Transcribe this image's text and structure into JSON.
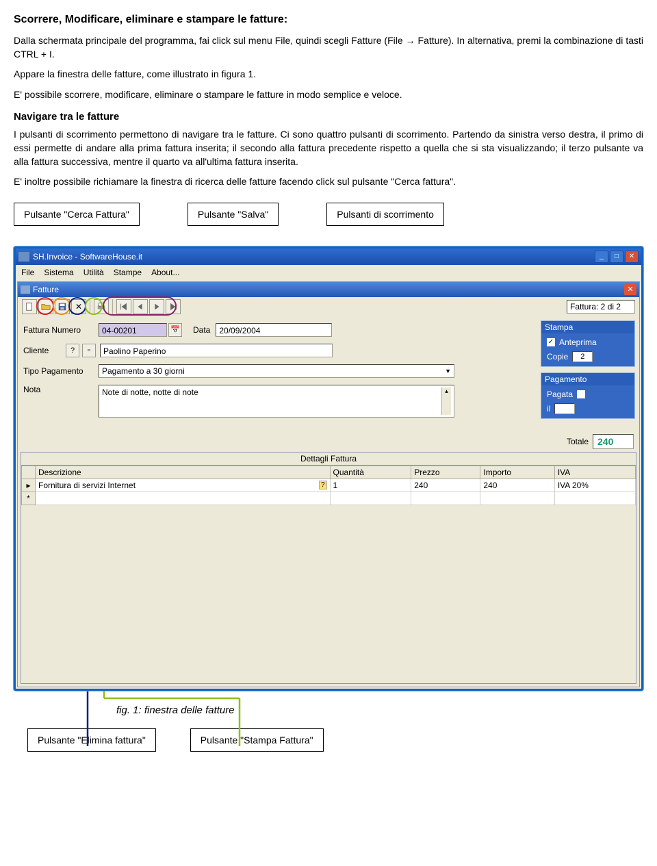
{
  "doc": {
    "h1": "Scorrere, Modificare, eliminare e stampare le fatture:",
    "p1": "Dalla schermata principale del programma, fai click sul menu File, quindi scegli Fatture (File → Fatture). In alternativa, premi la combinazione di tasti CTRL + I.",
    "p2": "Appare la finestra delle fatture, come illustrato in figura 1.",
    "p3": "E' possibile scorrere, modificare, eliminare o stampare le fatture in modo semplice e veloce.",
    "h2": "Navigare tra le fatture",
    "p4": "I pulsanti di scorrimento permettono di navigare tra le fatture. Ci sono quattro pulsanti di scorrimento. Partendo da sinistra verso destra, il primo di essi permette di andare alla prima fattura inserita; il secondo alla fattura precedente rispetto a quella che si sta visualizzando; il terzo pulsante va alla fattura successiva, mentre il quarto va all'ultima fattura inserita.",
    "p5": "E' inoltre possibile richiamare la finestra di ricerca delle fatture facendo click sul pulsante \"Cerca fattura\".",
    "annot": {
      "cerca": "Pulsante \"Cerca Fattura\"",
      "salva": "Pulsante \"Salva\"",
      "scroll": "Pulsanti di scorrimento",
      "elimina": "Pulsante \"Elimina fattura\"",
      "stampa": "Pulsante \"Stampa Fattura\""
    },
    "caption": "fig. 1: finestra delle fatture"
  },
  "app": {
    "title": "SH.Invoice - SoftwareHouse.it",
    "menu": [
      "File",
      "Sistema",
      "Utilità",
      "Stampe",
      "About..."
    ],
    "inner_title": "Fatture",
    "counter": "Fattura: 2 di 2",
    "form": {
      "num_label": "Fattura Numero",
      "num": "04-00201",
      "data_label": "Data",
      "data": "20/09/2004",
      "cliente_label": "Cliente",
      "cliente": "Paolino Paperino",
      "tipo_label": "Tipo Pagamento",
      "tipo": "Pagamento a 30 giorni",
      "nota_label": "Nota",
      "nota": "Note di notte, notte di note"
    },
    "stampa_group": {
      "title": "Stampa",
      "anteprima": "Anteprima",
      "copie_label": "Copie",
      "copie": "2"
    },
    "pagamento_group": {
      "title": "Pagamento",
      "pagata": "Pagata",
      "il": "il"
    },
    "totale_label": "Totale",
    "totale": "240",
    "grid": {
      "title": "Dettagli Fattura",
      "cols": [
        "Descrizione",
        "Quantità",
        "Prezzo",
        "Importo",
        "IVA"
      ],
      "rows": [
        {
          "desc": "Fornitura di servizi Internet",
          "q": "1",
          "p": "240",
          "imp": "240",
          "iva": "IVA 20%"
        }
      ]
    }
  }
}
